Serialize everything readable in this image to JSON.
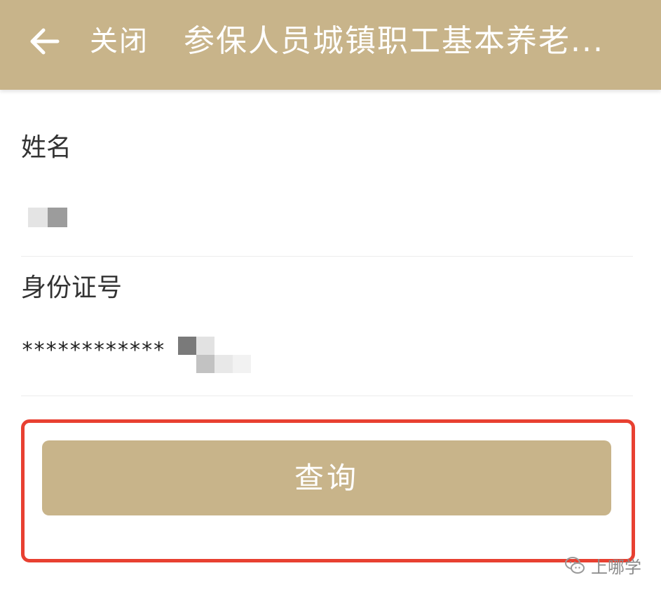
{
  "header": {
    "back_icon": "arrow-left-icon",
    "close_label": "关闭",
    "title": "参保人员城镇职工基本养老..."
  },
  "form": {
    "name_label": "姓名",
    "id_label": "身份证号",
    "id_value_masked": "************"
  },
  "actions": {
    "query_label": "查询"
  },
  "watermark": {
    "text": "上哪学"
  },
  "colors": {
    "accent": "#c8b48a",
    "highlight_border": "#e84031",
    "text": "#333333"
  }
}
